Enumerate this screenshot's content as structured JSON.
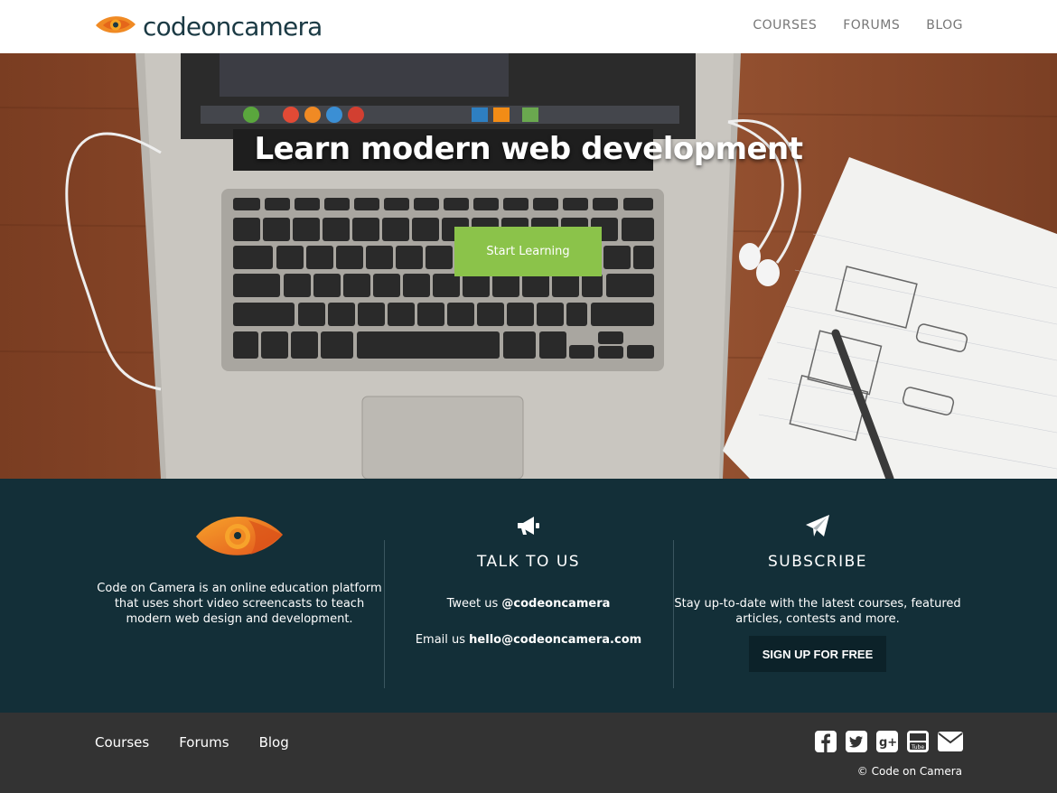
{
  "header": {
    "brand": "codeoncamera",
    "logo_icon": "eye-logo-icon",
    "nav": [
      {
        "label": "COURSES"
      },
      {
        "label": "FORUMS"
      },
      {
        "label": "BLOG"
      }
    ]
  },
  "hero": {
    "title": "Learn modern web development",
    "cta_label": "Start Learning"
  },
  "info": {
    "about": {
      "text_line1": "Code on Camera is an online education platform",
      "text_line2": "that uses short video screencasts to teach",
      "text_line3": "modern web design and development."
    },
    "talk": {
      "icon": "megaphone-icon",
      "heading": "TALK TO US",
      "tweet_prefix": "Tweet us ",
      "tweet_handle": "@codeoncamera",
      "email_prefix": "Email us ",
      "email_address": "hello@codeoncamera.com"
    },
    "subscribe": {
      "icon": "paper-plane-icon",
      "heading": "SUBSCRIBE",
      "text_line1": "Stay up-to-date with the latest courses, featured",
      "text_line2": "articles, contests and more.",
      "button_label": "SIGN UP FOR FREE"
    }
  },
  "footer": {
    "nav": [
      {
        "label": "Courses"
      },
      {
        "label": "Forums"
      },
      {
        "label": "Blog"
      }
    ],
    "social_icons": [
      "facebook-icon",
      "twitter-icon",
      "google-plus-icon",
      "youtube-icon",
      "email-icon"
    ],
    "copyright": "© Code on Camera"
  },
  "colors": {
    "accent_orange": "#f08a24",
    "cta_green": "#8bc34a",
    "band_dark": "#132f38",
    "footer_dark": "#333333"
  }
}
